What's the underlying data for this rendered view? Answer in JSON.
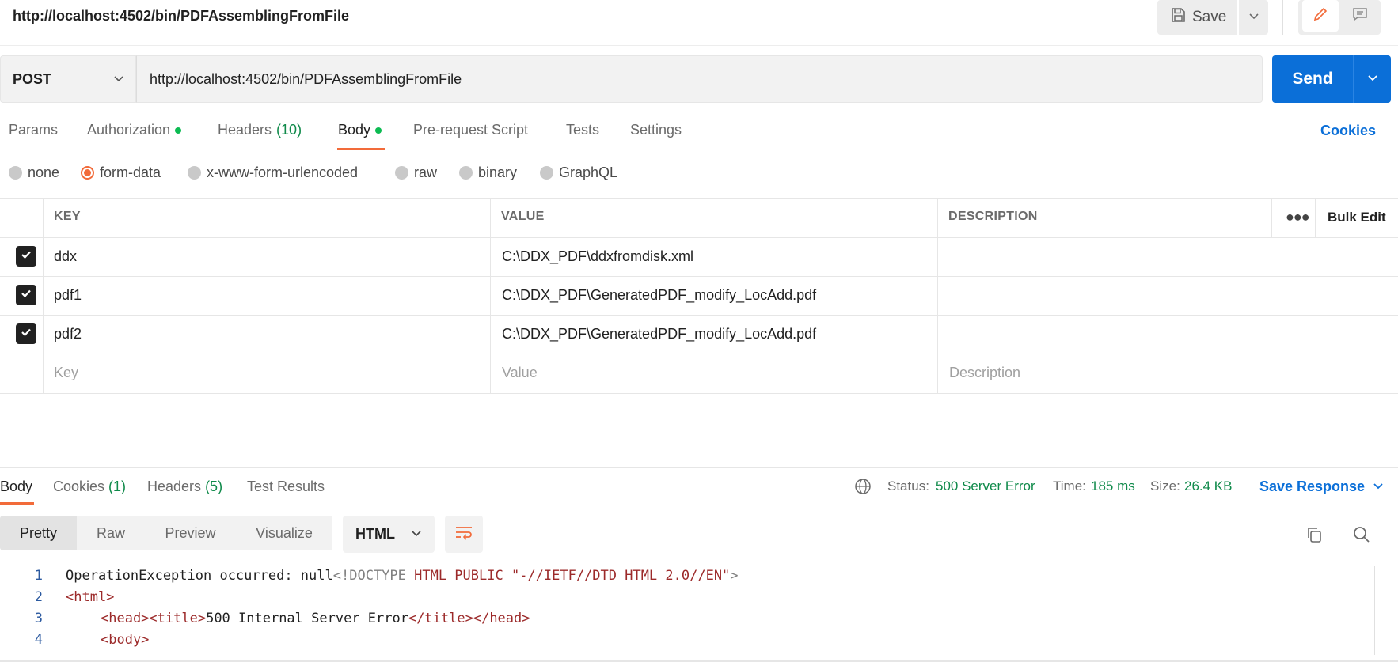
{
  "header": {
    "request_title": "http://localhost:4502/bin/PDFAssemblingFromFile",
    "save_label": "Save"
  },
  "request": {
    "method": "POST",
    "url": "http://localhost:4502/bin/PDFAssemblingFromFile",
    "send_label": "Send"
  },
  "tabs": {
    "params": "Params",
    "authorization": "Authorization",
    "headers": "Headers",
    "headers_count": "(10)",
    "body": "Body",
    "prerequest": "Pre-request Script",
    "tests": "Tests",
    "settings": "Settings",
    "cookies": "Cookies"
  },
  "body_modes": {
    "none": "none",
    "form_data": "form-data",
    "urlencoded": "x-www-form-urlencoded",
    "raw": "raw",
    "binary": "binary",
    "graphql": "GraphQL",
    "selected": "form-data"
  },
  "table": {
    "headers": {
      "key": "KEY",
      "value": "VALUE",
      "description": "DESCRIPTION",
      "bulk_edit": "Bulk Edit"
    },
    "rows": [
      {
        "key": "ddx",
        "value": "C:\\DDX_PDF\\ddxfromdisk.xml",
        "description": "",
        "checked": true
      },
      {
        "key": "pdf1",
        "value": "C:\\DDX_PDF\\GeneratedPDF_modify_LocAdd.pdf",
        "description": "",
        "checked": true
      },
      {
        "key": "pdf2",
        "value": "C:\\DDX_PDF\\GeneratedPDF_modify_LocAdd.pdf",
        "description": "",
        "checked": true
      }
    ],
    "placeholders": {
      "key": "Key",
      "value": "Value",
      "description": "Description"
    }
  },
  "response": {
    "tabs": {
      "body": "Body",
      "cookies": "Cookies",
      "cookies_count": "(1)",
      "headers": "Headers",
      "headers_count": "(5)",
      "test_results": "Test Results"
    },
    "status_label": "Status:",
    "status_value": "500 Server Error",
    "time_label": "Time:",
    "time_value": "185 ms",
    "size_label": "Size:",
    "size_value": "26.4 KB",
    "save_response": "Save Response",
    "views": {
      "pretty": "Pretty",
      "raw": "Raw",
      "preview": "Preview",
      "visualize": "Visualize"
    },
    "format": "HTML",
    "code_lines": [
      {
        "n": "1",
        "plain": "OperationException occurred: null",
        "doctype_open": "<!DOCTYPE",
        "doctype_rest": " HTML PUBLIC \"-//IETF//DTD HTML 2.0//EN\"",
        "doctype_close": ">"
      },
      {
        "n": "2",
        "text": "<html>"
      },
      {
        "n": "3",
        "t1": "<head>",
        "t2": "<title>",
        "txt": "500 Internal Server Error",
        "t3": "</title>",
        "t4": "</head>"
      },
      {
        "n": "4",
        "text": "<body>"
      }
    ]
  },
  "colors": {
    "accent_orange": "#f26b3a",
    "send_blue": "#0b6fd8",
    "status_green": "#0f8a4a"
  }
}
